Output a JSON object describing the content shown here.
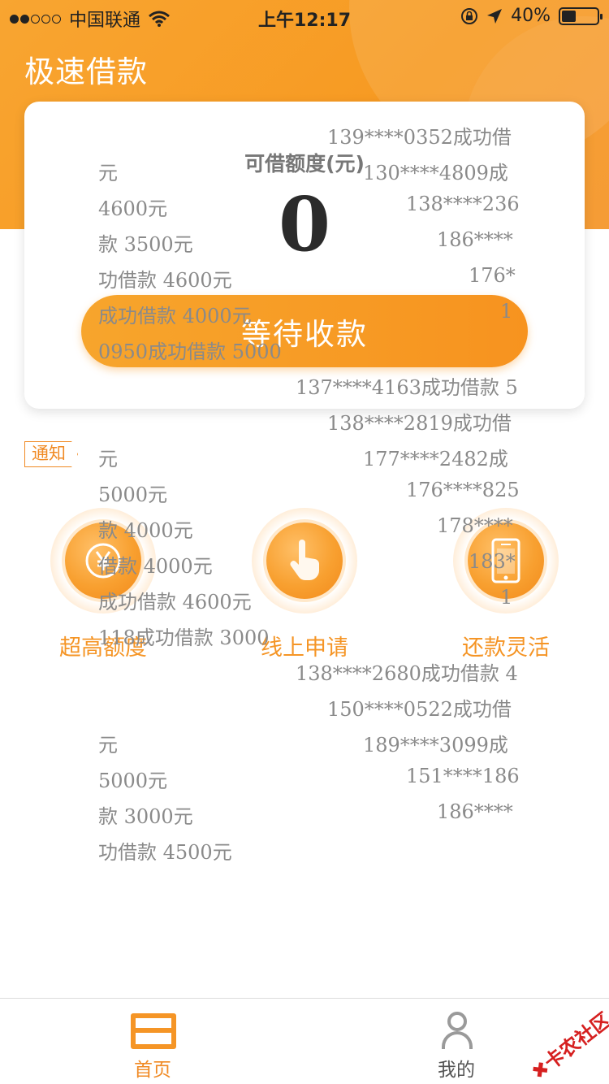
{
  "status_bar": {
    "carrier": "中国联通",
    "time": "上午12:17",
    "battery": "40%",
    "battery_level": 0.4
  },
  "header": {
    "title": "极速借款"
  },
  "card": {
    "limit_label": "可借额度(元)",
    "limit_value": "0",
    "button_label": "等待收款"
  },
  "notice": {
    "tag": "通知"
  },
  "ticker_lines": [
    "139****0352成功借",
    "元",
    "130****4809成",
    "4600元",
    "138****236",
    "款 3500元",
    "186****",
    "功借款 4600元",
    "176*",
    "成功借款 4000元",
    "1",
    "0950成功借款 5000",
    "137****4163成功借款 5",
    "138****2819成功借",
    "元",
    "177****2482成",
    "5000元",
    "176****825",
    "款 4000元",
    "178****",
    "借款 4000元",
    "183*",
    "成功借款 4600元",
    "1",
    "118成功借款 3000",
    "138****2680成功借款 4",
    "150****0522成功借",
    "元",
    "189****3099成",
    "5000元",
    "151****186",
    "款 3000元",
    "186****",
    "功借款 4500元"
  ],
  "features": [
    {
      "label": "超高额度",
      "icon": "yen-coin-icon"
    },
    {
      "label": "线上申请",
      "icon": "hand-pointer-icon"
    },
    {
      "label": "还款灵活",
      "icon": "phone-icon"
    }
  ],
  "tabbar": {
    "home": "首页",
    "mine": "我的"
  },
  "watermark": "卡农社区"
}
